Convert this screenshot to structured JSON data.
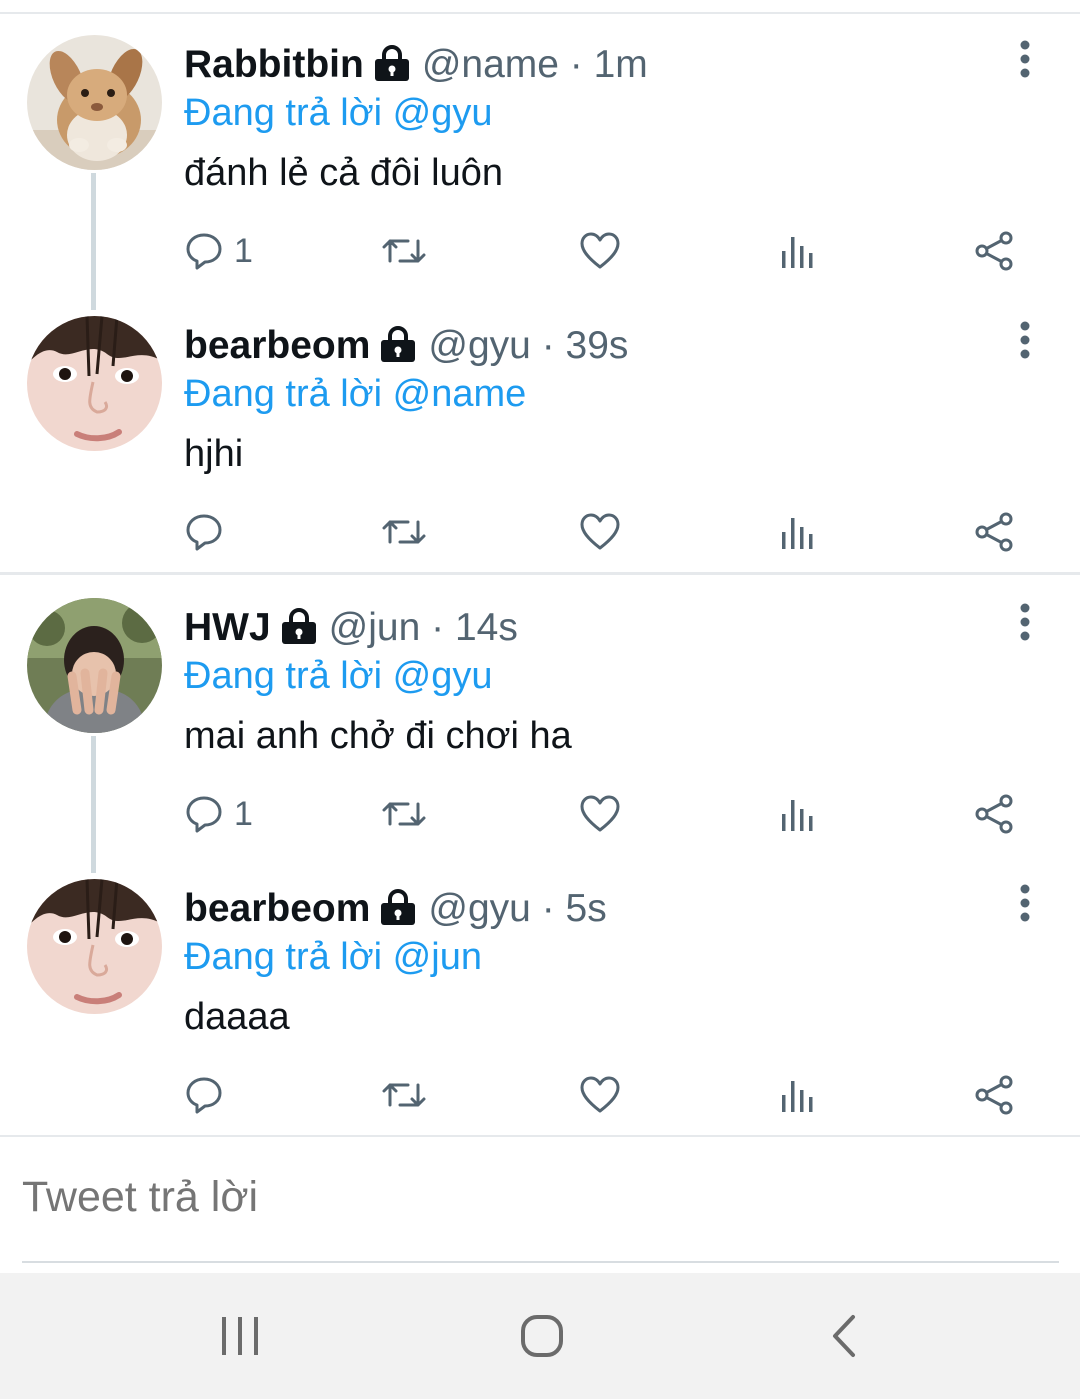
{
  "tweets": [
    {
      "display_name": "Rabbitbin",
      "handle_time": "@name · 1m",
      "reply_prefix": "Đang trả lời ",
      "reply_to": "@gyu",
      "text": "đánh lẻ cả đôi luôn",
      "reply_count": "1",
      "avatar_icon": "rabbit-photo"
    },
    {
      "display_name": "bearbeom",
      "handle_time": "@gyu · 39s",
      "reply_prefix": "Đang trả lời ",
      "reply_to": "@name",
      "text": "hjhi",
      "reply_count": "",
      "avatar_icon": "face-photo"
    },
    {
      "display_name": "HWJ",
      "handle_time": "@jun · 14s",
      "reply_prefix": "Đang trả lời ",
      "reply_to": "@gyu",
      "text": "mai anh chở đi chơi ha",
      "reply_count": "1",
      "avatar_icon": "person-covering-face-photo"
    },
    {
      "display_name": "bearbeom",
      "handle_time": "@gyu · 5s",
      "reply_prefix": "Đang trả lời ",
      "reply_to": "@jun",
      "text": "daaaa",
      "reply_count": "",
      "avatar_icon": "face-photo"
    }
  ],
  "composer": {
    "placeholder": "Tweet trả lời"
  },
  "colors": {
    "accent": "#1d9bf0",
    "muted": "#536471",
    "divider": "#e6e9ec"
  }
}
